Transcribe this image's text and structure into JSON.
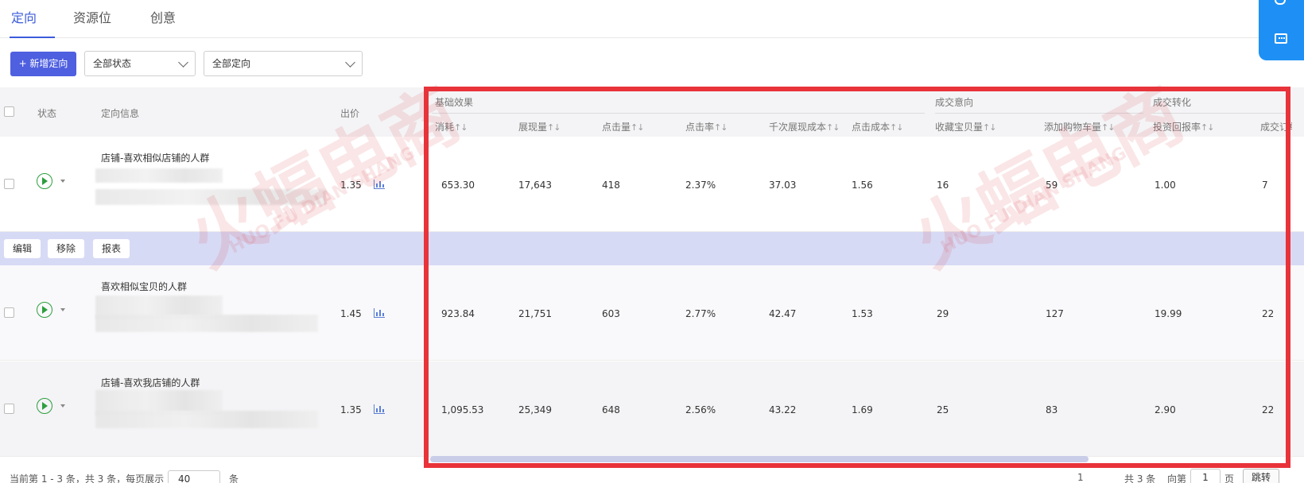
{
  "tabs": [
    {
      "label": "定向",
      "active": true
    },
    {
      "label": "资源位",
      "active": false
    },
    {
      "label": "创意",
      "active": false
    }
  ],
  "toolbar": {
    "add_button": "+ 新增定向",
    "status_select": "全部状态",
    "target_select": "全部定向"
  },
  "table": {
    "col_status": "状态",
    "col_info": "定向信息",
    "col_bid": "出价",
    "groups": {
      "basic": "基础效果",
      "intent": "成交意向",
      "conversion": "成交转化"
    },
    "metric_headers": [
      "消耗",
      "展现量",
      "点击量",
      "点击率",
      "千次展现成本",
      "点击成本",
      "收藏宝贝量",
      "添加购物车量",
      "投资回报率",
      "成交订单"
    ],
    "sort_icon": "↑↓",
    "rows": [
      {
        "name": "店铺-喜欢相似店铺的人群",
        "bid": "1.35",
        "values": [
          "653.30",
          "17,643",
          "418",
          "2.37%",
          "37.03",
          "1.56",
          "16",
          "59",
          "1.00",
          "7"
        ]
      },
      {
        "name": "喜欢相似宝贝的人群",
        "bid": "1.45",
        "values": [
          "923.84",
          "21,751",
          "603",
          "2.77%",
          "42.47",
          "1.53",
          "29",
          "127",
          "19.99",
          "22"
        ]
      },
      {
        "name": "店铺-喜欢我店铺的人群",
        "bid": "1.35",
        "values": [
          "1,095.53",
          "25,349",
          "648",
          "2.56%",
          "43.22",
          "1.69",
          "25",
          "83",
          "2.90",
          "22"
        ]
      }
    ],
    "row_actions": [
      "编辑",
      "移除",
      "报表"
    ]
  },
  "pagination": {
    "summary": "当前第 1 - 3 条，共 3 条，每页展示",
    "page_size": "40",
    "unit": "条",
    "current_page": "1",
    "total": "共 3 条",
    "goto_prefix": "向第",
    "goto_value": "1",
    "goto_suffix": "页",
    "goto_button": "跳转"
  },
  "watermark": {
    "brand": "火蝠电商",
    "pinyin": "HUO FU DIAN SHANG"
  },
  "colors": {
    "accent": "#3b5bdb",
    "primary_button": "#4e5fe0",
    "highlight": "#e8333a",
    "selected_row": "#d7daf5",
    "float_button": "#1e90f5"
  },
  "icons": [
    "bell-icon",
    "message-icon",
    "play-icon",
    "chart-icon",
    "chevron-down-icon",
    "edit-icon"
  ]
}
